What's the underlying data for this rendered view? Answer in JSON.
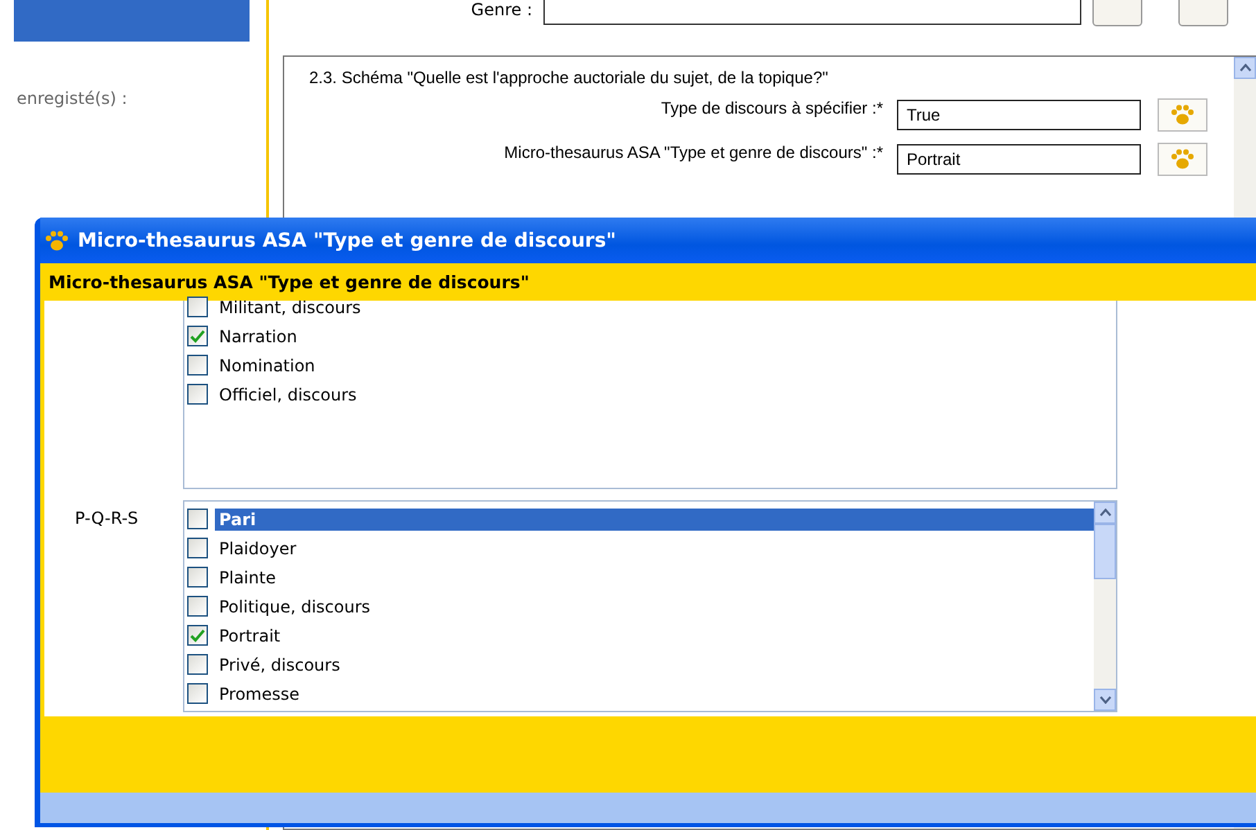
{
  "background": {
    "sidebar": {
      "label": "enregisté(s) :"
    },
    "genre": {
      "label": "Genre :"
    },
    "section": {
      "title": "2.3. Schéma \"Quelle est l'approche auctoriale du sujet, de la topique?\"",
      "fields": [
        {
          "label": "Type de discours à spécifier :*",
          "value": "True"
        },
        {
          "label": "Micro-thesaurus ASA \"Type et genre de discours\" :*",
          "value": "Portrait"
        }
      ]
    }
  },
  "dialog": {
    "title": "Micro-thesaurus ASA \"Type et genre de discours\"",
    "header": "Micro-thesaurus ASA \"Type et genre de discours\"",
    "groups": [
      {
        "items": [
          {
            "label": "Militant, discours",
            "checked": false,
            "selected": false
          },
          {
            "label": "Narration",
            "checked": true,
            "selected": false
          },
          {
            "label": "Nomination",
            "checked": false,
            "selected": false
          },
          {
            "label": "Officiel, discours",
            "checked": false,
            "selected": false
          }
        ]
      },
      {
        "label": "P-Q-R-S",
        "items": [
          {
            "label": "Pari",
            "checked": false,
            "selected": true
          },
          {
            "label": "Plaidoyer",
            "checked": false,
            "selected": false
          },
          {
            "label": "Plainte",
            "checked": false,
            "selected": false
          },
          {
            "label": "Politique, discours",
            "checked": false,
            "selected": false
          },
          {
            "label": "Portrait",
            "checked": true,
            "selected": false
          },
          {
            "label": "Privé, discours",
            "checked": false,
            "selected": false
          },
          {
            "label": "Promesse",
            "checked": false,
            "selected": false
          }
        ]
      }
    ]
  }
}
